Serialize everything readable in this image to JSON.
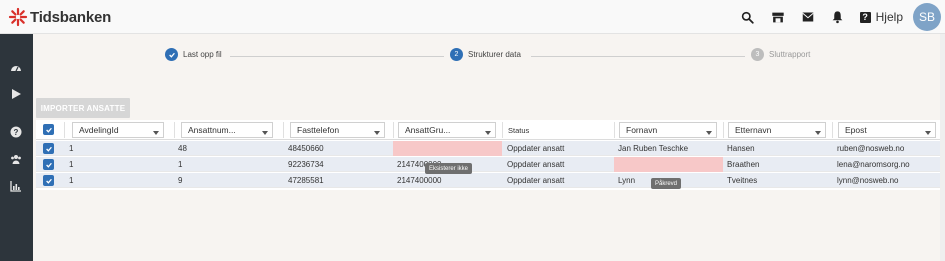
{
  "app": {
    "logo_text": "Tidsbanken",
    "help_label": "Hjelp",
    "avatar_initials": "SB"
  },
  "stepper": {
    "steps": [
      {
        "label": "Last opp fil",
        "state": "done",
        "number": ""
      },
      {
        "label": "Strukturer data",
        "state": "active",
        "number": "2"
      },
      {
        "label": "Sluttrapport",
        "state": "pending",
        "number": "3"
      }
    ]
  },
  "actions": {
    "import_label": "IMPORTER ANSATTE"
  },
  "table": {
    "columns": [
      "AvdelingId",
      "Ansattnum...",
      "Fasttelefon",
      "AnsattGru...",
      "Status",
      "Fornavn",
      "Etternavn",
      "Epost"
    ],
    "rows": [
      {
        "avdeling": "1",
        "ansattnr": "48",
        "telefon": "48450660",
        "gruppe": "",
        "status": "Oppdater ansatt",
        "fornavn": "Jan Ruben Teschke",
        "etternavn": "Hansen",
        "epost": "ruben@nosweb.no"
      },
      {
        "avdeling": "1",
        "ansattnr": "1",
        "telefon": "92236734",
        "gruppe": "2147400000",
        "status": "Oppdater ansatt",
        "fornavn": "",
        "etternavn": "Braathen",
        "epost": "lena@naromsorg.no"
      },
      {
        "avdeling": "1",
        "ansattnr": "9",
        "telefon": "47285581",
        "gruppe": "2147400000",
        "status": "Oppdater ansatt",
        "fornavn": "Lynn",
        "etternavn": "Tveitnes",
        "epost": "lynn@nosweb.no"
      }
    ],
    "tooltips": {
      "gruppe_error": "Eksisterer ikke",
      "fornavn_error": "Påkrevd"
    }
  },
  "colors": {
    "accent": "#2f6fb5",
    "sidebar": "#2d353c",
    "error_cell": "#f7c8c8",
    "selected_row": "#e8ecf3"
  },
  "icons": {
    "top": [
      "search-icon",
      "store-icon",
      "mail-icon",
      "bell-icon",
      "help-icon"
    ],
    "sidebar": [
      "dashboard-icon",
      "play-icon",
      "help-icon",
      "users-icon",
      "chart-icon"
    ]
  }
}
